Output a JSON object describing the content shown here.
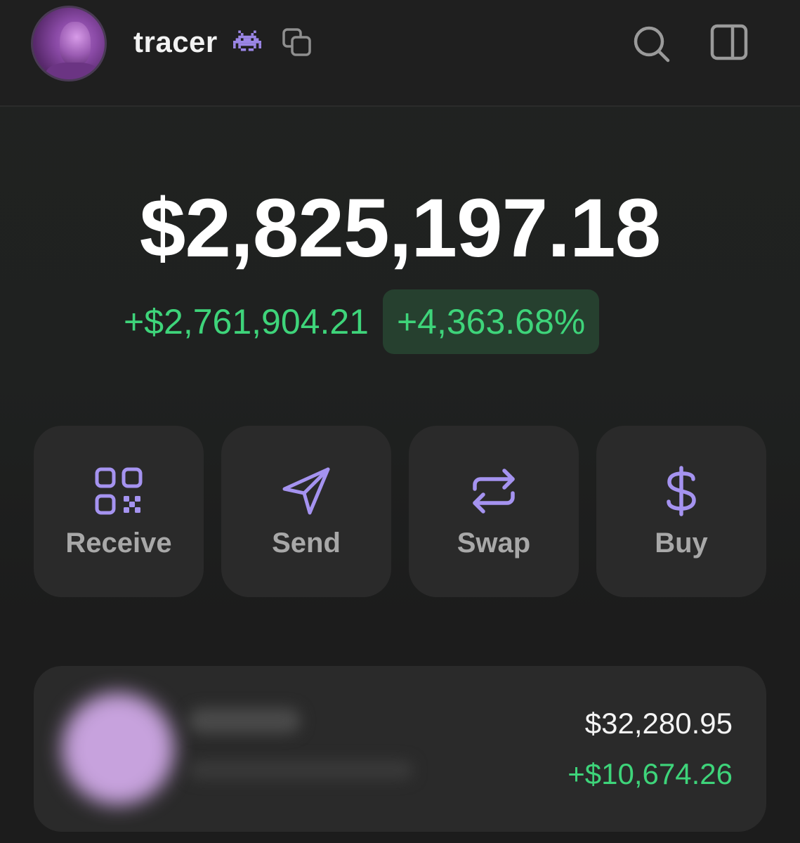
{
  "header": {
    "username": "tracer",
    "avatar_icon": "user-avatar",
    "badge_icon": "space-invader-icon",
    "copy_icon": "copy-icon",
    "search_icon": "search-icon",
    "sidebar_icon": "sidebar-panel-icon"
  },
  "portfolio": {
    "balance": "$2,825,197.18",
    "change_amount": "+$2,761,904.21",
    "change_percent": "+4,363.68%"
  },
  "actions": [
    {
      "label": "Receive",
      "icon": "qr-code-icon"
    },
    {
      "label": "Send",
      "icon": "send-icon"
    },
    {
      "label": "Swap",
      "icon": "swap-icon"
    },
    {
      "label": "Buy",
      "icon": "dollar-icon"
    }
  ],
  "tokens": [
    {
      "value": "$32,280.95",
      "change": "+$10,674.26"
    }
  ],
  "colors": {
    "accent": "#a593f0",
    "positive": "#3ed47a",
    "background": "#1e1e1e",
    "card": "#2a2a2a"
  }
}
